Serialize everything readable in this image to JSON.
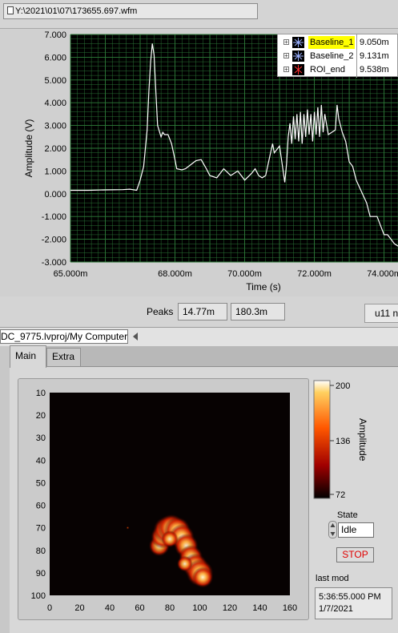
{
  "file_path": "Y:\\2021\\01\\07\\173655.697.wfm",
  "waveform_chart": {
    "ylabel": "Amplitude (V)",
    "xlabel": "Time (s)",
    "y_ticks": [
      "7.000",
      "6.000",
      "5.000",
      "4.000",
      "3.000",
      "2.000",
      "1.000",
      "0.000",
      "-1.000",
      "-2.000",
      "-3.000"
    ],
    "x_ticks": [
      "65.000m",
      "68.000m",
      "70.000m",
      "72.000m",
      "74.000m"
    ],
    "plot_bg": "#000000",
    "grid_color": "#2e7d3a",
    "trace_color": "#ffffff"
  },
  "legend": {
    "items": [
      {
        "name": "Baseline_1",
        "value": "9.050m",
        "highlight": "#ffff00",
        "symbol_color": "#9ab0ff"
      },
      {
        "name": "Baseline_2",
        "value": "9.131m",
        "highlight": "",
        "symbol_color": "#9ab0ff"
      },
      {
        "name": "ROI_end",
        "value": "9.538m",
        "highlight": "",
        "symbol_color": "#ff3030"
      }
    ]
  },
  "peaks": {
    "label": "Peaks",
    "value_1": "14.77m",
    "value_2": "180.3m"
  },
  "right_box_text": "u11 n",
  "project_path": "DC_9775.lvproj/My Computer",
  "tabs": [
    {
      "label": "Main"
    },
    {
      "label": "Extra"
    }
  ],
  "intensity_graph": {
    "y_ticks": [
      "10",
      "20",
      "30",
      "40",
      "50",
      "60",
      "70",
      "80",
      "90",
      "100"
    ],
    "x_ticks": [
      "0",
      "20",
      "40",
      "60",
      "80",
      "100",
      "120",
      "140",
      "160"
    ],
    "colorbar_label": "Amplitude",
    "colorbar_ticks": [
      "200",
      "136",
      "72"
    ]
  },
  "state": {
    "label": "State",
    "value": "Idle"
  },
  "stop_label": "STOP",
  "last_mod": {
    "label": "last mod",
    "time": "5:36:55.000 PM",
    "date": "1/7/2021"
  },
  "chart_data": [
    {
      "type": "line",
      "xlabel": "Time (s)",
      "ylabel": "Amplitude (V)",
      "xlim": [
        65.0,
        74.4
      ],
      "ylim": [
        -3.0,
        7.0
      ],
      "grid": true,
      "legend_position": "top-right",
      "series": [
        {
          "x": [
            65.0,
            65.5,
            66.0,
            66.5,
            66.7,
            66.9,
            67.0,
            67.1,
            67.2,
            67.25,
            67.3,
            67.35,
            67.4,
            67.45,
            67.5,
            67.6,
            67.65,
            67.7,
            67.8,
            67.9,
            68.0,
            68.05,
            68.2,
            68.3,
            68.6,
            68.75,
            68.9,
            69.0,
            69.2,
            69.4,
            69.6,
            69.8,
            70.0,
            70.2,
            70.3,
            70.4,
            70.5,
            70.6,
            70.7,
            70.8,
            70.85,
            71.0,
            71.15,
            71.2,
            71.25,
            71.3,
            71.35,
            71.4,
            71.45,
            71.5,
            71.55,
            71.6,
            71.65,
            71.7,
            71.75,
            71.8,
            71.85,
            71.9,
            71.95,
            72.0,
            72.05,
            72.1,
            72.15,
            72.2,
            72.25,
            72.3,
            72.4,
            72.5,
            72.6,
            72.65,
            72.7,
            72.8,
            72.9,
            73.0,
            73.1,
            73.2,
            73.35,
            73.5,
            73.6,
            73.8,
            73.9,
            74.0,
            74.1,
            74.2,
            74.3,
            74.4
          ],
          "y": [
            0.15,
            0.15,
            0.17,
            0.18,
            0.2,
            0.15,
            0.6,
            1.2,
            2.8,
            4.5,
            5.8,
            6.6,
            6.1,
            4.5,
            3.0,
            2.5,
            2.7,
            2.6,
            2.6,
            2.2,
            1.5,
            1.1,
            1.05,
            1.1,
            1.45,
            1.5,
            1.1,
            0.8,
            0.7,
            1.1,
            0.8,
            1.0,
            0.6,
            0.9,
            1.1,
            0.8,
            0.7,
            0.8,
            1.5,
            2.2,
            1.8,
            2.1,
            0.5,
            1.3,
            2.5,
            3.1,
            2.2,
            3.4,
            2.4,
            3.5,
            2.3,
            3.6,
            2.2,
            3.5,
            2.5,
            3.7,
            2.6,
            3.5,
            2.3,
            3.6,
            2.6,
            3.8,
            2.5,
            3.9,
            2.7,
            3.5,
            2.6,
            2.7,
            2.8,
            3.9,
            3.3,
            2.7,
            2.3,
            1.4,
            1.2,
            0.6,
            0.1,
            -0.4,
            -1.0,
            -1.0,
            -1.4,
            -1.8,
            -1.8,
            -2.0,
            -2.2,
            -2.3
          ]
        }
      ]
    },
    {
      "type": "heatmap",
      "colorbar_label": "Amplitude",
      "xlim": [
        0,
        160
      ],
      "ylim": [
        100,
        10
      ],
      "zlim": [
        72,
        200
      ],
      "background_value": 72,
      "features": [
        {
          "x": 81,
          "y": 70,
          "value": 200
        },
        {
          "x": 100,
          "y": 90,
          "value": 195
        },
        {
          "x": 52,
          "y": 70,
          "value": 100
        }
      ]
    }
  ]
}
